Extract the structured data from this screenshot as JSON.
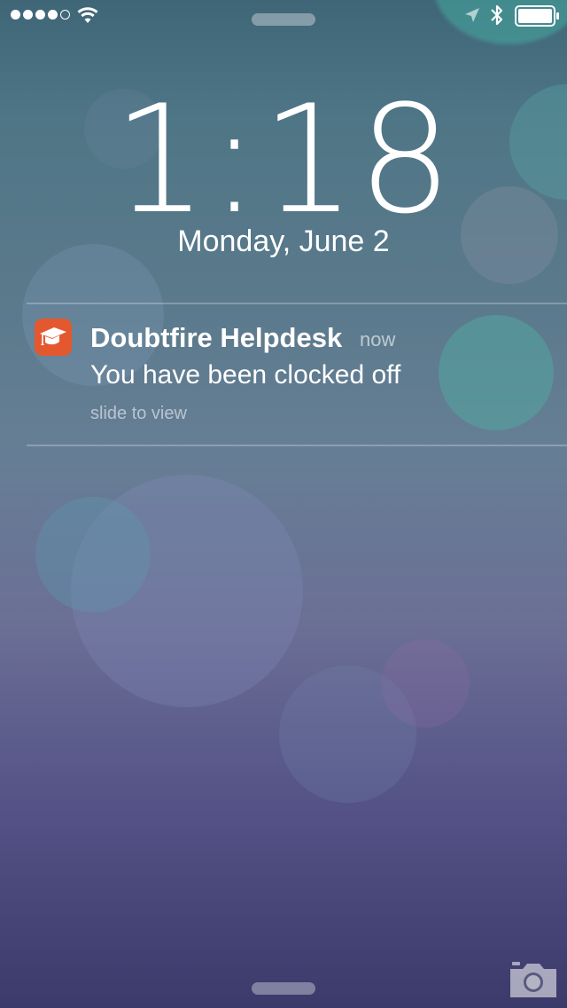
{
  "status_bar": {
    "signal_filled_dots": 4,
    "signal_total_dots": 5,
    "icons": [
      "wifi-icon",
      "location-arrow-icon",
      "bluetooth-icon",
      "battery-icon"
    ]
  },
  "lockscreen": {
    "time": "1:18",
    "date": "Monday, June 2"
  },
  "notification": {
    "app_name": "Doubtfire Helpdesk",
    "time_ago": "now",
    "message": "You have been clocked off",
    "slide_hint": "slide to view",
    "icon": "graduation-cap-icon",
    "icon_color": "#e4582f"
  },
  "bottom": {
    "camera_icon": "camera-icon"
  }
}
